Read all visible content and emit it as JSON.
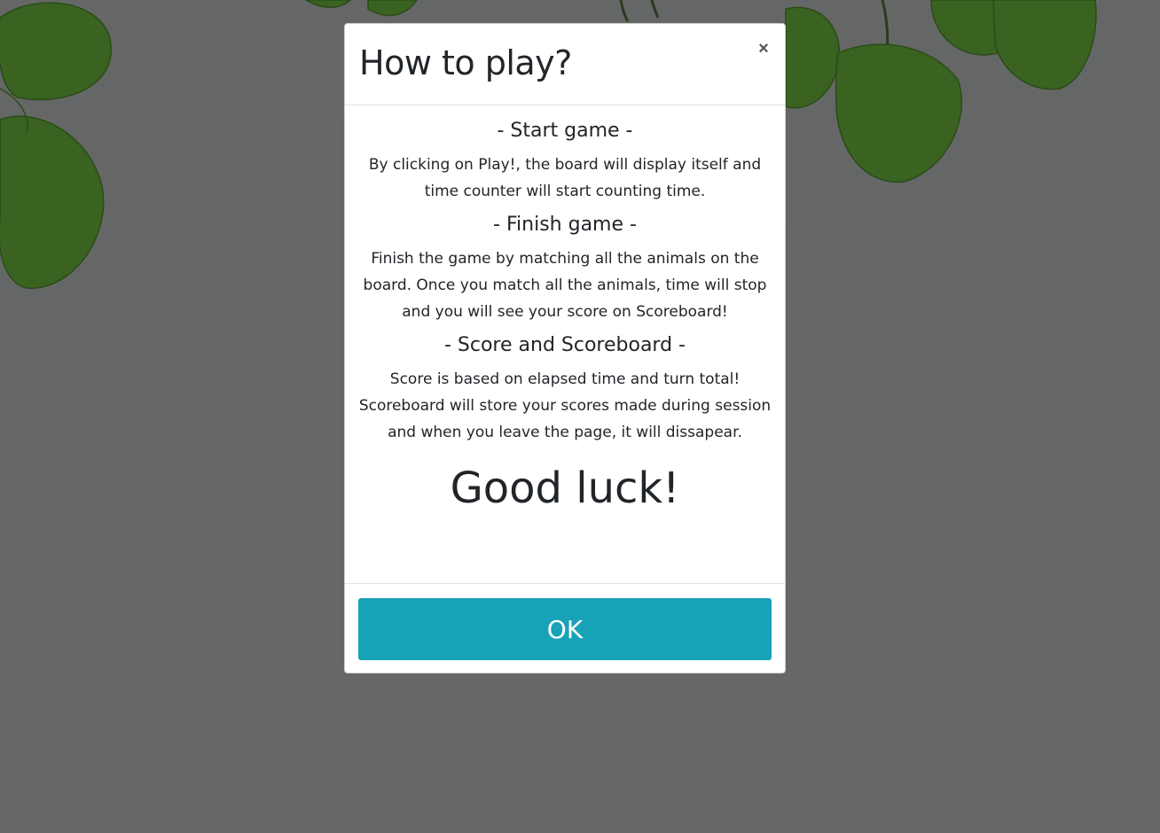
{
  "modal": {
    "title": "How to play?",
    "close_symbol": "×",
    "sections": [
      {
        "heading": "- Start game -",
        "text": "By clicking on Play!, the board will display itself and time counter will start counting time."
      },
      {
        "heading": "- Finish game -",
        "text": "Finish the game by matching all the animals on the board. Once you match all the animals, time will stop and you will see your score on Scoreboard!"
      },
      {
        "heading": "- Score and Scoreboard -",
        "text": "Score is based on elapsed time and turn total! Scoreboard will store your scores made during session and when you leave the page, it will dissapear."
      }
    ],
    "closing": "Good luck!",
    "ok_label": "OK"
  },
  "colors": {
    "accent": "#17a2b8",
    "leaf": "#6ab33c",
    "backdrop": "#b9bcbc"
  },
  "icons": {
    "close": "close-icon",
    "background": "leaves-image"
  }
}
